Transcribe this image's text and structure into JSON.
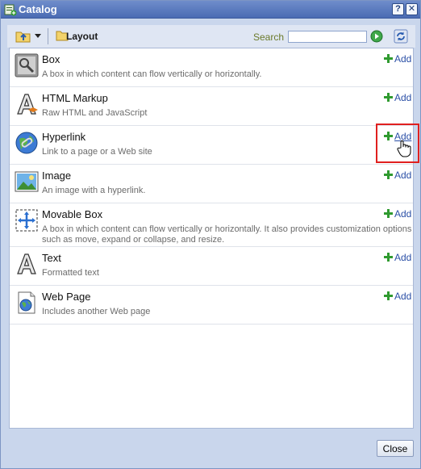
{
  "window": {
    "title": "Catalog"
  },
  "titlebar": {
    "help_label": "?",
    "close_label": "✕"
  },
  "toolbar": {
    "layout_label": "Layout",
    "search_label": "Search",
    "search_value": ""
  },
  "items": [
    {
      "title": "Box",
      "desc": "A box in which content can flow vertically or horizontally.",
      "add_label": "Add",
      "icon": "box-icon"
    },
    {
      "title": "HTML Markup",
      "desc": "Raw HTML and JavaScript",
      "add_label": "Add",
      "icon": "html-markup-icon"
    },
    {
      "title": "Hyperlink",
      "desc": "Link to a page or a Web site",
      "add_label": "Add",
      "icon": "hyperlink-icon"
    },
    {
      "title": "Image",
      "desc": "An image with a hyperlink.",
      "add_label": "Add",
      "icon": "image-icon"
    },
    {
      "title": "Movable Box",
      "desc": "A box in which content can flow vertically or horizontally. It also provides customization options such as move, expand or collapse, and resize.",
      "add_label": "Add",
      "icon": "movable-box-icon"
    },
    {
      "title": "Text",
      "desc": "Formatted text",
      "add_label": "Add",
      "icon": "text-icon"
    },
    {
      "title": "Web Page",
      "desc": "Includes another Web page",
      "add_label": "Add",
      "icon": "web-page-icon"
    }
  ],
  "footer": {
    "close_label": "Close"
  },
  "colors": {
    "accent": "#2a4fa6",
    "highlight": "#e0201f",
    "plus": "#2f9a2f"
  }
}
